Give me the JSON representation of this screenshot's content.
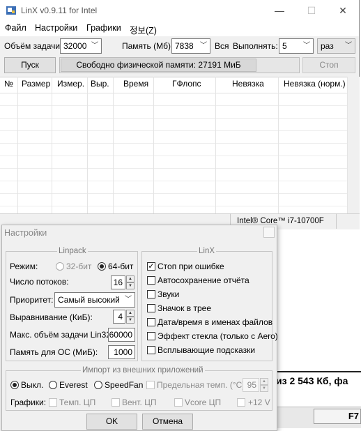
{
  "window": {
    "title": "LinX v0.9.11 for Intel",
    "minimize": "—",
    "maximize": "☐",
    "close": "✕"
  },
  "menu": [
    "Файл",
    "Настройки",
    "Графики",
    "정보(Z)"
  ],
  "toolbar": {
    "problem_size_label": "Объём задачи:",
    "problem_size_value": "32000",
    "memory_label": "Память (Мб):",
    "memory_value": "7838",
    "all_label": "Вся",
    "run_label": "Выполнять:",
    "run_value": "5",
    "run_unit": "раз",
    "start_button": "Пуск",
    "free_memory": "Свободно физической памяти: 27191 МиБ",
    "stop_button": "Стоп"
  },
  "table": {
    "columns": [
      "№",
      "Размер",
      "Измер.",
      "Выр.",
      "Время",
      "ГФлопс",
      "Невязка",
      "Невязка (норм.)"
    ]
  },
  "status": {
    "cpu": "Intel® Core™ i7-10700F"
  },
  "background": {
    "text": "из 2 543 Кб, фа",
    "button": "F7"
  },
  "settings": {
    "title": "Настройки",
    "linpack": {
      "title": "Linpack",
      "mode_label": "Режим:",
      "mode_32": "32-бит",
      "mode_64": "64-бит",
      "threads_label": "Число потоков:",
      "threads_value": "16",
      "priority_label": "Приоритет:",
      "priority_value": "Самый высокий",
      "alignment_label": "Выравнивание (КиБ):",
      "alignment_value": "4",
      "max_lin32_label": "Макс. объём задачи Lin32:",
      "max_lin32_value": "60000",
      "os_memory_label": "Память для ОС (МиБ):",
      "os_memory_value": "1000"
    },
    "linx": {
      "title": "LinX",
      "options": [
        {
          "label": "Стоп при ошибке",
          "checked": true
        },
        {
          "label": "Автосохранение отчёта",
          "checked": false
        },
        {
          "label": "Звуки",
          "checked": false
        },
        {
          "label": "Значок в трее",
          "checked": false
        },
        {
          "label": "Дата/время в именах файлов",
          "checked": false
        },
        {
          "label": "Эффект стекла (только с Aero)",
          "checked": false
        },
        {
          "label": "Всплывающие подсказки",
          "checked": false
        }
      ]
    },
    "import": {
      "title": "Импорт из внешних приложений",
      "off": "Выкл.",
      "everest": "Everest",
      "speedfan": "SpeedFan",
      "max_temp_label": "Предельная темп. (°C):",
      "max_temp_value": "95",
      "graphs_label": "Графики:",
      "graph_cpu_temp": "Темп. ЦП",
      "graph_cpu_fan": "Вент. ЦП",
      "graph_vcore": "Vcore ЦП",
      "graph_12v": "+12 V"
    },
    "ok_button": "OK",
    "cancel_button": "Отмена"
  }
}
